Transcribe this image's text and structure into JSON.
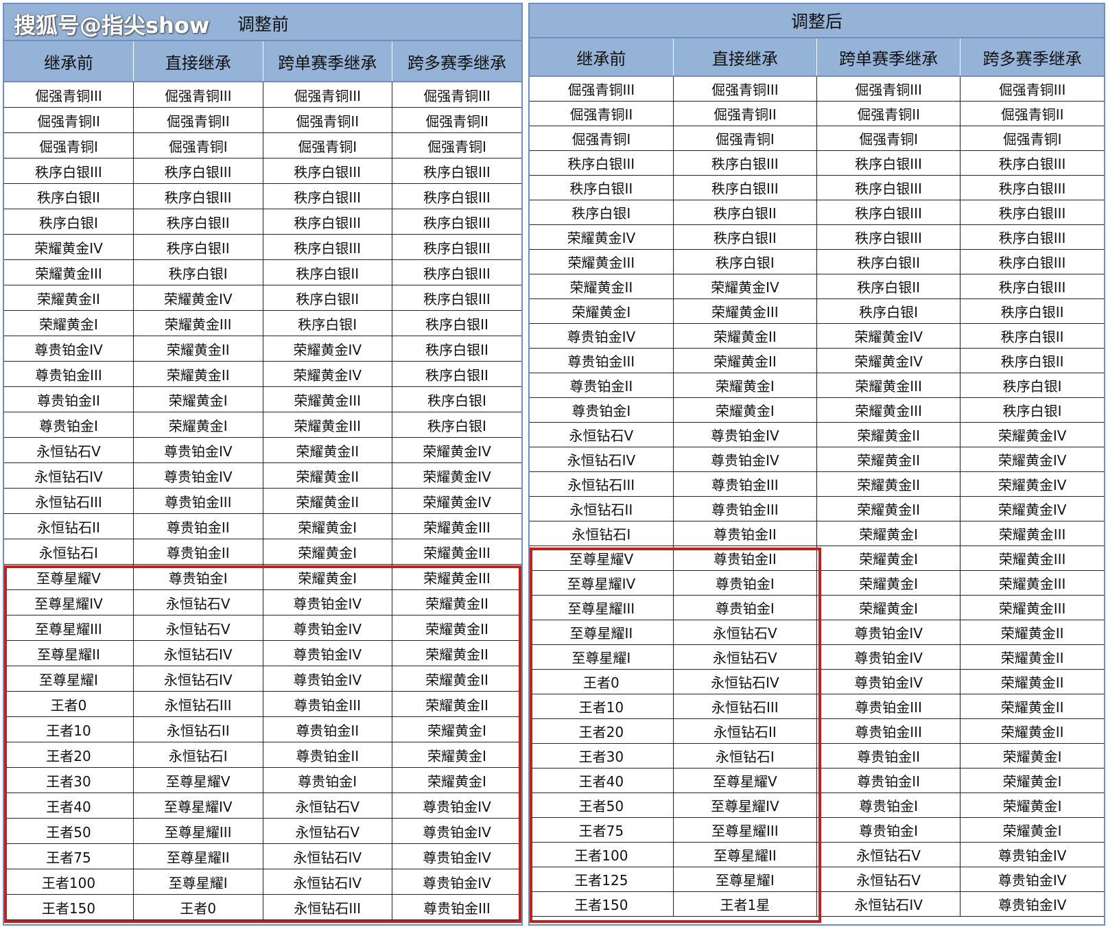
{
  "watermark": "搜狐号@指尖show",
  "left_table": {
    "title": "调整前",
    "headers": [
      "继承前",
      "直接继承",
      "跨单赛季继承",
      "跨多赛季继承"
    ],
    "rows": [
      [
        "倔强青铜III",
        "倔强青铜III",
        "倔强青铜III",
        "倔强青铜III"
      ],
      [
        "倔强青铜II",
        "倔强青铜II",
        "倔强青铜II",
        "倔强青铜II"
      ],
      [
        "倔强青铜I",
        "倔强青铜I",
        "倔强青铜I",
        "倔强青铜I"
      ],
      [
        "秩序白银III",
        "秩序白银III",
        "秩序白银III",
        "秩序白银III"
      ],
      [
        "秩序白银II",
        "秩序白银III",
        "秩序白银III",
        "秩序白银III"
      ],
      [
        "秩序白银I",
        "秩序白银II",
        "秩序白银III",
        "秩序白银III"
      ],
      [
        "荣耀黄金IV",
        "秩序白银II",
        "秩序白银III",
        "秩序白银III"
      ],
      [
        "荣耀黄金III",
        "秩序白银I",
        "秩序白银II",
        "秩序白银III"
      ],
      [
        "荣耀黄金II",
        "荣耀黄金IV",
        "秩序白银II",
        "秩序白银III"
      ],
      [
        "荣耀黄金I",
        "荣耀黄金III",
        "秩序白银I",
        "秩序白银II"
      ],
      [
        "尊贵铂金IV",
        "荣耀黄金II",
        "荣耀黄金IV",
        "秩序白银II"
      ],
      [
        "尊贵铂金III",
        "荣耀黄金II",
        "荣耀黄金IV",
        "秩序白银II"
      ],
      [
        "尊贵铂金II",
        "荣耀黄金I",
        "荣耀黄金III",
        "秩序白银I"
      ],
      [
        "尊贵铂金I",
        "荣耀黄金I",
        "荣耀黄金III",
        "秩序白银I"
      ],
      [
        "永恒钻石V",
        "尊贵铂金IV",
        "荣耀黄金II",
        "荣耀黄金IV"
      ],
      [
        "永恒钻石IV",
        "尊贵铂金IV",
        "荣耀黄金II",
        "荣耀黄金IV"
      ],
      [
        "永恒钻石III",
        "尊贵铂金III",
        "荣耀黄金II",
        "荣耀黄金IV"
      ],
      [
        "永恒钻石II",
        "尊贵铂金II",
        "荣耀黄金I",
        "荣耀黄金III"
      ],
      [
        "永恒钻石I",
        "尊贵铂金II",
        "荣耀黄金I",
        "荣耀黄金III"
      ],
      [
        "至尊星耀V",
        "尊贵铂金I",
        "荣耀黄金I",
        "荣耀黄金III"
      ],
      [
        "至尊星耀IV",
        "永恒钻石V",
        "尊贵铂金IV",
        "荣耀黄金II"
      ],
      [
        "至尊星耀III",
        "永恒钻石V",
        "尊贵铂金IV",
        "荣耀黄金II"
      ],
      [
        "至尊星耀II",
        "永恒钻石IV",
        "尊贵铂金IV",
        "荣耀黄金II"
      ],
      [
        "至尊星耀I",
        "永恒钻石IV",
        "尊贵铂金IV",
        "荣耀黄金II"
      ],
      [
        "王者0",
        "永恒钻石III",
        "尊贵铂金III",
        "荣耀黄金II"
      ],
      [
        "王者10",
        "永恒钻石II",
        "尊贵铂金II",
        "荣耀黄金I"
      ],
      [
        "王者20",
        "永恒钻石I",
        "尊贵铂金II",
        "荣耀黄金I"
      ],
      [
        "王者30",
        "至尊星耀V",
        "尊贵铂金I",
        "荣耀黄金I"
      ],
      [
        "王者40",
        "至尊星耀IV",
        "永恒钻石V",
        "尊贵铂金IV"
      ],
      [
        "王者50",
        "至尊星耀III",
        "永恒钻石V",
        "尊贵铂金IV"
      ],
      [
        "王者75",
        "至尊星耀II",
        "永恒钻石IV",
        "尊贵铂金IV"
      ],
      [
        "王者100",
        "至尊星耀I",
        "永恒钻石IV",
        "尊贵铂金IV"
      ],
      [
        "王者150",
        "王者0",
        "永恒钻石III",
        "尊贵铂金III"
      ]
    ]
  },
  "right_table": {
    "title": "调整后",
    "headers": [
      "继承前",
      "直接继承",
      "跨单赛季继承",
      "跨多赛季继承"
    ],
    "rows": [
      [
        "倔强青铜III",
        "倔强青铜III",
        "倔强青铜III",
        "倔强青铜III"
      ],
      [
        "倔强青铜II",
        "倔强青铜II",
        "倔强青铜II",
        "倔强青铜II"
      ],
      [
        "倔强青铜I",
        "倔强青铜I",
        "倔强青铜I",
        "倔强青铜I"
      ],
      [
        "秩序白银III",
        "秩序白银III",
        "秩序白银III",
        "秩序白银III"
      ],
      [
        "秩序白银II",
        "秩序白银III",
        "秩序白银III",
        "秩序白银III"
      ],
      [
        "秩序白银I",
        "秩序白银II",
        "秩序白银III",
        "秩序白银III"
      ],
      [
        "荣耀黄金IV",
        "秩序白银II",
        "秩序白银III",
        "秩序白银III"
      ],
      [
        "荣耀黄金III",
        "秩序白银I",
        "秩序白银II",
        "秩序白银III"
      ],
      [
        "荣耀黄金II",
        "荣耀黄金IV",
        "秩序白银II",
        "秩序白银III"
      ],
      [
        "荣耀黄金I",
        "荣耀黄金III",
        "秩序白银I",
        "秩序白银II"
      ],
      [
        "尊贵铂金IV",
        "荣耀黄金II",
        "荣耀黄金IV",
        "秩序白银II"
      ],
      [
        "尊贵铂金III",
        "荣耀黄金II",
        "荣耀黄金IV",
        "秩序白银II"
      ],
      [
        "尊贵铂金II",
        "荣耀黄金I",
        "荣耀黄金III",
        "秩序白银I"
      ],
      [
        "尊贵铂金I",
        "荣耀黄金I",
        "荣耀黄金III",
        "秩序白银I"
      ],
      [
        "永恒钻石V",
        "尊贵铂金IV",
        "荣耀黄金II",
        "荣耀黄金IV"
      ],
      [
        "永恒钻石IV",
        "尊贵铂金IV",
        "荣耀黄金II",
        "荣耀黄金IV"
      ],
      [
        "永恒钻石III",
        "尊贵铂金III",
        "荣耀黄金II",
        "荣耀黄金IV"
      ],
      [
        "永恒钻石II",
        "尊贵铂金III",
        "荣耀黄金II",
        "荣耀黄金IV"
      ],
      [
        "永恒钻石I",
        "尊贵铂金II",
        "荣耀黄金I",
        "荣耀黄金III"
      ],
      [
        "至尊星耀V",
        "尊贵铂金II",
        "荣耀黄金I",
        "荣耀黄金III"
      ],
      [
        "至尊星耀IV",
        "尊贵铂金I",
        "荣耀黄金I",
        "荣耀黄金III"
      ],
      [
        "至尊星耀III",
        "尊贵铂金I",
        "荣耀黄金I",
        "荣耀黄金III"
      ],
      [
        "至尊星耀II",
        "永恒钻石V",
        "尊贵铂金IV",
        "荣耀黄金II"
      ],
      [
        "至尊星耀I",
        "永恒钻石V",
        "尊贵铂金IV",
        "荣耀黄金II"
      ],
      [
        "王者0",
        "永恒钻石IV",
        "尊贵铂金IV",
        "荣耀黄金II"
      ],
      [
        "王者10",
        "永恒钻石III",
        "尊贵铂金III",
        "荣耀黄金II"
      ],
      [
        "王者20",
        "永恒钻石II",
        "尊贵铂金III",
        "荣耀黄金II"
      ],
      [
        "王者30",
        "永恒钻石I",
        "尊贵铂金II",
        "荣耀黄金I"
      ],
      [
        "王者40",
        "至尊星耀V",
        "尊贵铂金II",
        "荣耀黄金I"
      ],
      [
        "王者50",
        "至尊星耀IV",
        "尊贵铂金I",
        "荣耀黄金I"
      ],
      [
        "王者75",
        "至尊星耀III",
        "尊贵铂金I",
        "荣耀黄金I"
      ],
      [
        "王者100",
        "至尊星耀II",
        "永恒钻石V",
        "尊贵铂金IV"
      ],
      [
        "王者125",
        "至尊星耀I",
        "永恒钻石V",
        "尊贵铂金IV"
      ],
      [
        "王者150",
        "王者1星",
        "永恒钻石IV",
        "尊贵铂金IV"
      ]
    ]
  },
  "colors": {
    "header_bg": "#95b3d7",
    "highlight_border": "#c0201a",
    "grid_line": "#222222"
  }
}
